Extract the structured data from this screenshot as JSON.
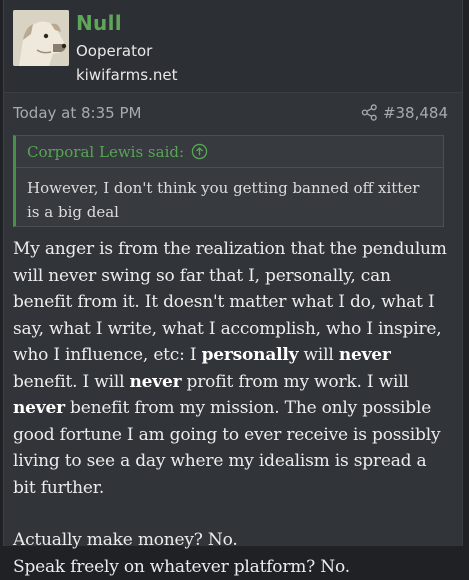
{
  "user": {
    "name": "Null",
    "title": "Ooperator",
    "banner": "kiwifarms.net"
  },
  "post": {
    "date": "Today at 8:35 PM",
    "number": "#38,484"
  },
  "quote": {
    "author": "Corporal Lewis said:",
    "text": "However, I don't think you getting banned off xitter is a big deal"
  },
  "message": {
    "p1": {
      "t1": "My anger is from the realization that the pendulum will never swing so far that I, personally, can benefit from it. It doesn't matter what I do, what I say, what I write, what I accomplish, who I inspire, who I influence, etc: I ",
      "b1": "personally",
      "t2": " will ",
      "b2": "never",
      "t3": " benefit. I will ",
      "b3": "never",
      "t4": " profit from my work. I will ",
      "b4": "never",
      "t5": " benefit from my mission. The only possible good fortune I am going to ever receive is possibly living to see a day where my idealism is spread a bit further."
    },
    "line2": "Actually make money? No.",
    "line3": "Speak freely on whatever platform? No."
  },
  "colors": {
    "username": "#5fa65a",
    "quote_accent": "#4a8e4b",
    "background": "#313438"
  },
  "icons": {
    "share": "share-icon",
    "quote_jump": "arrow-up-circle-icon"
  }
}
